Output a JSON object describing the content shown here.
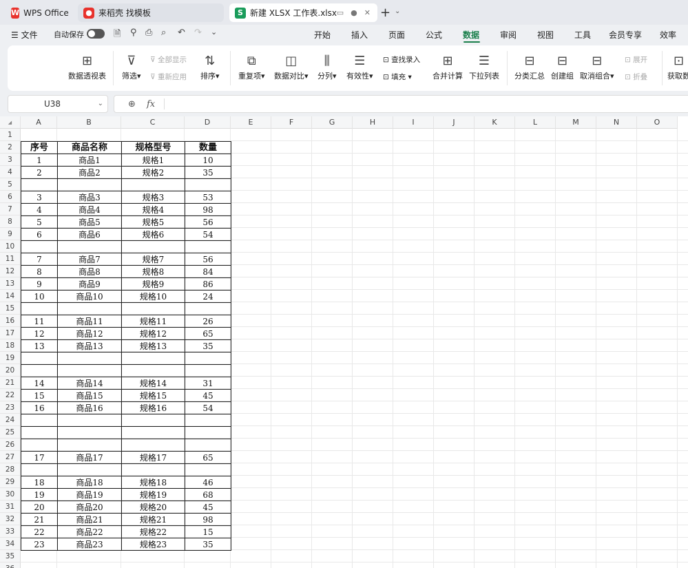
{
  "tabs": [
    {
      "label": "WPS Office",
      "icon": "wps-logo-icon"
    },
    {
      "label": "来稻壳 找模板",
      "icon": "docer-icon"
    },
    {
      "label": "新建 XLSX 工作表.xlsx",
      "icon": "spreadsheet-icon"
    }
  ],
  "menu": {
    "file": "文件",
    "autosave": "自动保存",
    "items": [
      "开始",
      "插入",
      "页面",
      "公式",
      "数据",
      "审阅",
      "视图",
      "工具",
      "会员专享",
      "效率"
    ],
    "active": "数据"
  },
  "ribbon": {
    "pivot": "数据透视表",
    "filter": "筛选",
    "show_all": "全部显示",
    "reapply": "重新应用",
    "sort": "排序",
    "duplicates": "重复项",
    "compare": "数据对比",
    "split": "分列",
    "validity": "有效性",
    "find_entry": "查找录入",
    "fill": "填充",
    "consolidate": "合并计算",
    "dropdown": "下拉列表",
    "subtotal": "分类汇总",
    "group": "创建组",
    "ungroup": "取消组合",
    "expand": "展开",
    "collapse": "折叠",
    "get_data": "获取数"
  },
  "formula_bar": {
    "cell_ref": "U38",
    "fx": "fx",
    "value": ""
  },
  "columns": [
    "A",
    "B",
    "C",
    "D",
    "E",
    "F",
    "G",
    "H",
    "I",
    "J",
    "K",
    "L",
    "M",
    "N",
    "O"
  ],
  "table": {
    "headers": [
      "序号",
      "商品名称",
      "规格型号",
      "数量"
    ],
    "rows": [
      [
        "1",
        "商品1",
        "规格1",
        "10"
      ],
      [
        "2",
        "商品2",
        "规格2",
        "35"
      ],
      [
        "",
        "",
        "",
        ""
      ],
      [
        "3",
        "商品3",
        "规格3",
        "53"
      ],
      [
        "4",
        "商品4",
        "规格4",
        "98"
      ],
      [
        "5",
        "商品5",
        "规格5",
        "56"
      ],
      [
        "6",
        "商品6",
        "规格6",
        "54"
      ],
      [
        "",
        "",
        "",
        ""
      ],
      [
        "7",
        "商品7",
        "规格7",
        "56"
      ],
      [
        "8",
        "商品8",
        "规格8",
        "84"
      ],
      [
        "9",
        "商品9",
        "规格9",
        "86"
      ],
      [
        "10",
        "商品10",
        "规格10",
        "24"
      ],
      [
        "",
        "",
        "",
        ""
      ],
      [
        "11",
        "商品11",
        "规格11",
        "26"
      ],
      [
        "12",
        "商品12",
        "规格12",
        "65"
      ],
      [
        "13",
        "商品13",
        "规格13",
        "35"
      ],
      [
        "",
        "",
        "",
        ""
      ],
      [
        "",
        "",
        "",
        ""
      ],
      [
        "14",
        "商品14",
        "规格14",
        "31"
      ],
      [
        "15",
        "商品15",
        "规格15",
        "45"
      ],
      [
        "16",
        "商品16",
        "规格16",
        "54"
      ],
      [
        "",
        "",
        "",
        ""
      ],
      [
        "",
        "",
        "",
        ""
      ],
      [
        "",
        "",
        "",
        ""
      ],
      [
        "17",
        "商品17",
        "规格17",
        "65"
      ],
      [
        "",
        "",
        "",
        ""
      ],
      [
        "18",
        "商品18",
        "规格18",
        "46"
      ],
      [
        "19",
        "商品19",
        "规格19",
        "68"
      ],
      [
        "20",
        "商品20",
        "规格20",
        "45"
      ],
      [
        "21",
        "商品21",
        "规格21",
        "98"
      ],
      [
        "22",
        "商品22",
        "规格22",
        "15"
      ],
      [
        "23",
        "商品23",
        "规格23",
        "35"
      ]
    ]
  },
  "colors": {
    "accent": "#1a7f4b",
    "wps_red": "#e8322c",
    "sheet_green": "#1a9c5b"
  }
}
